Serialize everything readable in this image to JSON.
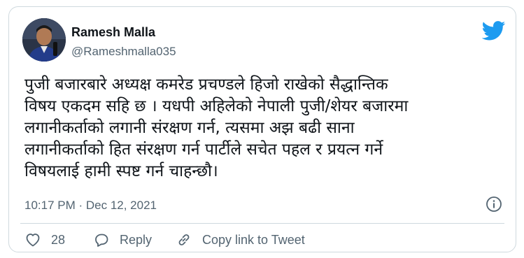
{
  "tweet": {
    "author_name": "Ramesh Malla",
    "author_handle": "@Rameshmalla035",
    "text": "पुजी बजारबारे अध्यक्ष कमरेड प्रचण्डले हिजो राखेको सैद्धान्तिक\nविषय एकदम सहि छ । यधपी अहिलेको नेपाली पुजी/शेयर बजारमा\nलगानीकर्ताको लगानी संरक्षण गर्न, त्यसमा अझ बढी साना\nलगानीकर्ताको हित संरक्षण गर्न पार्टीले सचेत पहल र प्रयत्न गर्ने\nविषयलाई हामी स्पष्ट गर्न चाहन्छौ।",
    "timestamp": "10:17 PM · Dec 12, 2021"
  },
  "actions": {
    "like_count": "28",
    "reply_label": "Reply",
    "copy_label": "Copy link to Tweet"
  },
  "icons": {
    "brand": "twitter-bird-icon",
    "info": "info-icon",
    "like": "heart-icon",
    "reply": "speech-bubble-icon",
    "copy": "link-icon"
  },
  "colors": {
    "brand_blue": "#1d9bf0",
    "text_primary": "#0f1419",
    "text_secondary": "#536471",
    "border": "#cfd9de"
  }
}
